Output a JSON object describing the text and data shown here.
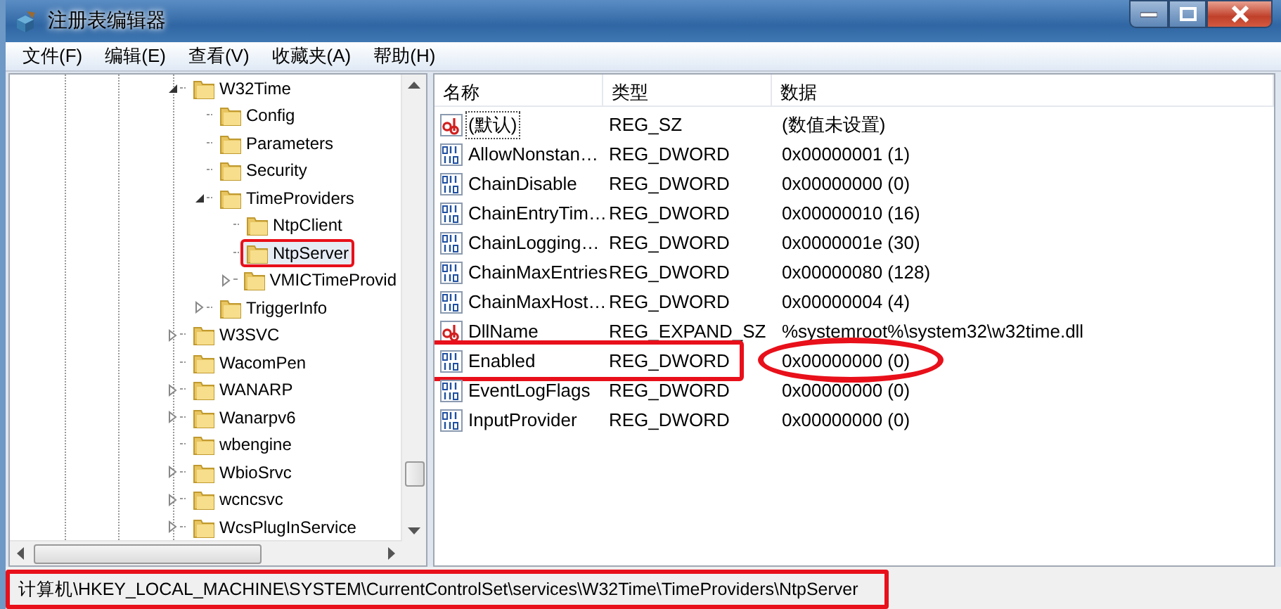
{
  "window": {
    "title": "注册表编辑器"
  },
  "menu": [
    "文件(F)",
    "编辑(E)",
    "查看(V)",
    "收藏夹(A)",
    "帮助(H)"
  ],
  "tree": [
    {
      "label": "W32Time",
      "kind": "branch",
      "expanded": true,
      "selected": false,
      "highlighted": false,
      "children": [
        {
          "label": "Config",
          "kind": "leaf",
          "selected": false,
          "highlighted": false
        },
        {
          "label": "Parameters",
          "kind": "leaf",
          "selected": false,
          "highlighted": false
        },
        {
          "label": "Security",
          "kind": "leaf",
          "selected": false,
          "highlighted": false
        },
        {
          "label": "TimeProviders",
          "kind": "branch",
          "expanded": true,
          "selected": false,
          "highlighted": false,
          "children": [
            {
              "label": "NtpClient",
              "kind": "leaf",
              "selected": false,
              "highlighted": false
            },
            {
              "label": "NtpServer",
              "kind": "leaf",
              "selected": true,
              "highlighted": true
            },
            {
              "label": "VMICTimeProvid",
              "kind": "branch",
              "expanded": false,
              "selected": false,
              "highlighted": false
            }
          ]
        },
        {
          "label": "TriggerInfo",
          "kind": "branch",
          "expanded": false,
          "selected": false,
          "highlighted": false
        }
      ]
    },
    {
      "label": "W3SVC",
      "kind": "branch",
      "expanded": false,
      "selected": false,
      "highlighted": false
    },
    {
      "label": "WacomPen",
      "kind": "leaf",
      "selected": false,
      "highlighted": false
    },
    {
      "label": "WANARP",
      "kind": "branch",
      "expanded": false,
      "selected": false,
      "highlighted": false
    },
    {
      "label": "Wanarpv6",
      "kind": "branch",
      "expanded": false,
      "selected": false,
      "highlighted": false
    },
    {
      "label": "wbengine",
      "kind": "leaf",
      "selected": false,
      "highlighted": false
    },
    {
      "label": "WbioSrvc",
      "kind": "branch",
      "expanded": false,
      "selected": false,
      "highlighted": false
    },
    {
      "label": "wcncsvc",
      "kind": "branch",
      "expanded": false,
      "selected": false,
      "highlighted": false
    },
    {
      "label": "WcsPlugInService",
      "kind": "branch",
      "expanded": false,
      "selected": false,
      "highlighted": false
    }
  ],
  "values": {
    "columns": [
      "名称",
      "类型",
      "数据"
    ],
    "rows": [
      {
        "kind": "string",
        "name": "(默认)",
        "type": "REG_SZ",
        "data": "(数值未设置)",
        "focused": true,
        "highlighted": false
      },
      {
        "kind": "dword",
        "name": "AllowNonstan…",
        "type": "REG_DWORD",
        "data": "0x00000001 (1)",
        "focused": false,
        "highlighted": false
      },
      {
        "kind": "dword",
        "name": "ChainDisable",
        "type": "REG_DWORD",
        "data": "0x00000000 (0)",
        "focused": false,
        "highlighted": false
      },
      {
        "kind": "dword",
        "name": "ChainEntryTim…",
        "type": "REG_DWORD",
        "data": "0x00000010 (16)",
        "focused": false,
        "highlighted": false
      },
      {
        "kind": "dword",
        "name": "ChainLogging…",
        "type": "REG_DWORD",
        "data": "0x0000001e (30)",
        "focused": false,
        "highlighted": false
      },
      {
        "kind": "dword",
        "name": "ChainMaxEntries",
        "type": "REG_DWORD",
        "data": "0x00000080 (128)",
        "focused": false,
        "highlighted": false
      },
      {
        "kind": "dword",
        "name": "ChainMaxHost…",
        "type": "REG_DWORD",
        "data": "0x00000004 (4)",
        "focused": false,
        "highlighted": false
      },
      {
        "kind": "string",
        "name": "DllName",
        "type": "REG_EXPAND_SZ",
        "data": "%systemroot%\\system32\\w32time.dll",
        "focused": false,
        "highlighted": false
      },
      {
        "kind": "dword",
        "name": "Enabled",
        "type": "REG_DWORD",
        "data": "0x00000000 (0)",
        "focused": false,
        "highlighted": true
      },
      {
        "kind": "dword",
        "name": "EventLogFlags",
        "type": "REG_DWORD",
        "data": "0x00000000 (0)",
        "focused": false,
        "highlighted": false
      },
      {
        "kind": "dword",
        "name": "InputProvider",
        "type": "REG_DWORD",
        "data": "0x00000000 (0)",
        "focused": false,
        "highlighted": false
      }
    ]
  },
  "status_bar": {
    "path": "计算机\\HKEY_LOCAL_MACHINE\\SYSTEM\\CurrentControlSet\\services\\W32Time\\TimeProviders\\NtpServer",
    "highlighted": true
  }
}
